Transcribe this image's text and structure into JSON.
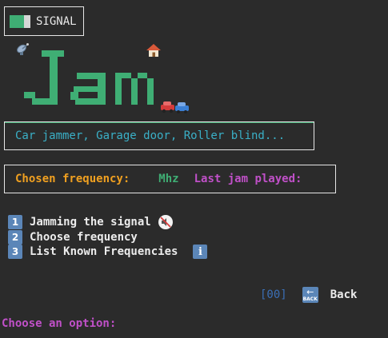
{
  "header": {
    "signal_label": "SIGNAL",
    "signal_icon": "signal-strength-icon"
  },
  "logo": {
    "title": "Jam",
    "icons": [
      "satellite-antenna-icon",
      "house-icon",
      "cars-icon"
    ],
    "color": "#3fae74"
  },
  "description": {
    "text": "Car jammer, Garage door, Roller blind..."
  },
  "status": {
    "frequency_label": "Chosen frequency:",
    "frequency_unit": "Mhz",
    "last_jam_label": "Last jam played:"
  },
  "menu": {
    "items": [
      {
        "key": "1",
        "label": "Jamming the signal",
        "icon": "mute-icon"
      },
      {
        "key": "2",
        "label": "Choose frequency"
      },
      {
        "key": "3",
        "label": "List Known Frequencies",
        "icon": "info-icon"
      }
    ]
  },
  "footer": {
    "back_code": "[00]",
    "back_icon_text": "BACK",
    "back_label": "Back",
    "prompt": "Choose an option:"
  },
  "colors": {
    "background": "#2b2b2b",
    "green": "#3fae74",
    "cyan": "#3ab0c7",
    "orange": "#f0a020",
    "magenta": "#c050c8",
    "blue": "#3b6fb6"
  }
}
